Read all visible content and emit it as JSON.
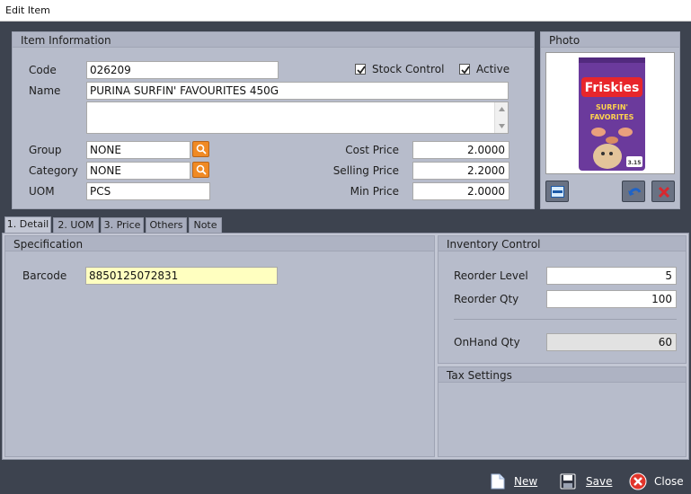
{
  "window": {
    "title": "Edit Item"
  },
  "item_info": {
    "heading": "Item Information",
    "code_label": "Code",
    "code": "026209",
    "name_label": "Name",
    "name": "PURINA SURFIN' FAVOURITES 450G",
    "stock_control_label": "Stock Control",
    "active_label": "Active",
    "group_label": "Group",
    "group": "NONE",
    "category_label": "Category",
    "category": "NONE",
    "uom_label": "UOM",
    "uom": "PCS",
    "cost_price_label": "Cost Price",
    "cost_price": "2.0000",
    "selling_price_label": "Selling Price",
    "selling_price": "2.2000",
    "min_price_label": "Min Price",
    "min_price": "2.0000"
  },
  "photo": {
    "heading": "Photo",
    "brand": "Friskies",
    "line1": "SURFIN'",
    "line2": "FAVORITES",
    "weight": "3.15"
  },
  "tabs": [
    "1. Detail",
    "2. UOM",
    "3. Price",
    "Others",
    "Note"
  ],
  "specification": {
    "heading": "Specification",
    "barcode_label": "Barcode",
    "barcode": "8850125072831"
  },
  "inventory": {
    "heading": "Inventory Control",
    "reorder_level_label": "Reorder Level",
    "reorder_level": "5",
    "reorder_qty_label": "Reorder Qty",
    "reorder_qty": "100",
    "onhand_label": "OnHand Qty",
    "onhand": "60"
  },
  "tax": {
    "heading": "Tax Settings"
  },
  "footer": {
    "new_label": "New",
    "save_label": "Save",
    "close_label": "Close"
  },
  "colors": {
    "accent_orange": "#f08a24",
    "panel": "#b7bccb",
    "close_red": "#e2352b"
  }
}
